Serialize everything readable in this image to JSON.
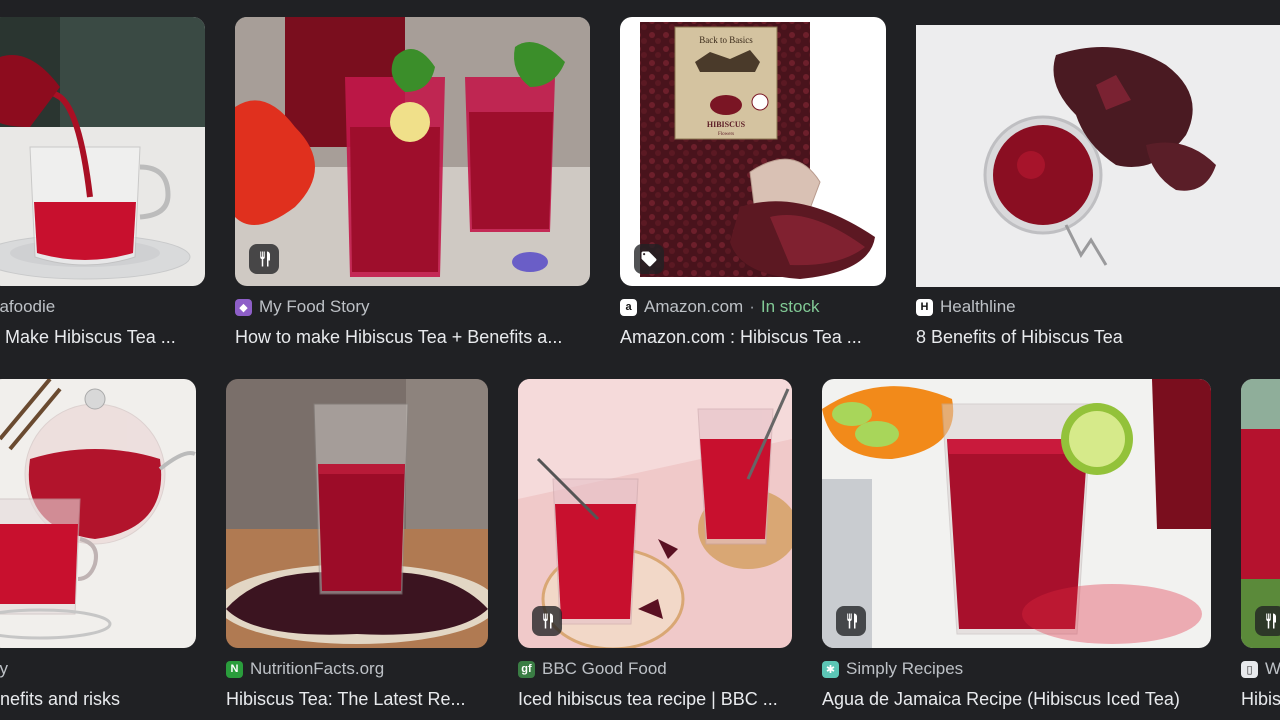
{
  "colors": {
    "background": "#202124",
    "source_text": "#bdc1c6",
    "title_text": "#e8eaed",
    "in_stock": "#81c995"
  },
  "row1": [
    {
      "source": "hafoodie",
      "title": "o Make Hibiscus Tea ...",
      "badge": "none"
    },
    {
      "source": "My Food Story",
      "title": "How to make Hibiscus Tea + Benefits a...",
      "badge": "recipe-icon"
    },
    {
      "source": "Amazon.com",
      "separator": "·",
      "stock": "In stock",
      "title": "Amazon.com : Hibiscus Tea ...",
      "badge": "price-tag-icon"
    },
    {
      "source": "Healthline",
      "title": "8 Benefits of Hibiscus Tea",
      "badge": "none"
    }
  ],
  "row2": [
    {
      "source": "ay",
      "title": "enefits and risks",
      "badge": "none"
    },
    {
      "source": "NutritionFacts.org",
      "title": "Hibiscus Tea: The Latest Re...",
      "badge": "none"
    },
    {
      "source": "BBC Good Food",
      "title": "Iced hibiscus tea recipe | BBC ...",
      "badge": "recipe-icon"
    },
    {
      "source": "Simply Recipes",
      "title": "Agua de Jamaica Recipe (Hibiscus Iced Tea)",
      "badge": "recipe-icon"
    },
    {
      "source": "W",
      "title": "Hibis",
      "badge": "recipe-icon"
    }
  ],
  "product_label": {
    "brand": "Back to Basics",
    "name": "HIBISCUS",
    "sub": "Flowers"
  }
}
